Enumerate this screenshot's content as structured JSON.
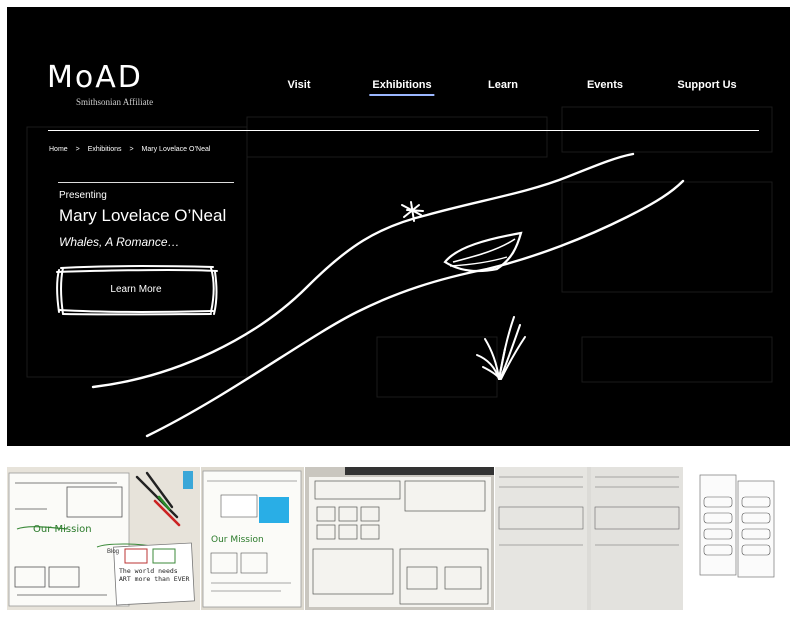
{
  "logo": {
    "main": "MoAD",
    "sub": "Smithsonian Affiliate"
  },
  "nav": [
    {
      "label": "Visit"
    },
    {
      "label": "Exhibitions",
      "active": true
    },
    {
      "label": "Learn"
    },
    {
      "label": "Events"
    },
    {
      "label": "Support Us"
    }
  ],
  "breadcrumb": {
    "home": "Home",
    "section": "Exhibitions",
    "current": "Mary Lovelace O’Neal",
    "separator": ">"
  },
  "hero": {
    "presenting": "Presenting",
    "artist": "Mary Lovelace O’Neal",
    "exhibition": "Whales, A Romance…",
    "cta": "Learn More"
  },
  "sketch_photo_1": {
    "mission": "Our Mission",
    "blog": "Blog",
    "quote": "The world needs ART more than EVER"
  },
  "sketch_photo_2": {
    "mission": "Our Mission"
  },
  "colors": {
    "hero_bg": "#000000",
    "accent_underline": "#9bb7ff",
    "sticky_note": "#29aee6"
  }
}
